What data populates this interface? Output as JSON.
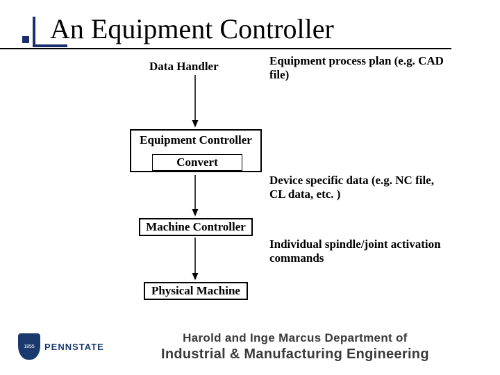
{
  "title": "An Equipment Controller",
  "labels": {
    "data_handler": "Data Handler",
    "equipment_controller": "Equipment Controller",
    "convert": "Convert",
    "machine_controller": "Machine Controller",
    "physical_machine": "Physical Machine"
  },
  "annotations": {
    "input": "Equipment process plan (e.g. CAD file)",
    "after_convert": "Device specific data (e.g. NC file, CL data, etc. )",
    "after_machine_ctrl": "Individual spindle/joint activation commands"
  },
  "footer": {
    "logo_text": "PENNSTATE",
    "shield_year": "1855",
    "dept_line1": "Harold and Inge Marcus Department of",
    "dept_line2": "Industrial & Manufacturing Engineering"
  }
}
